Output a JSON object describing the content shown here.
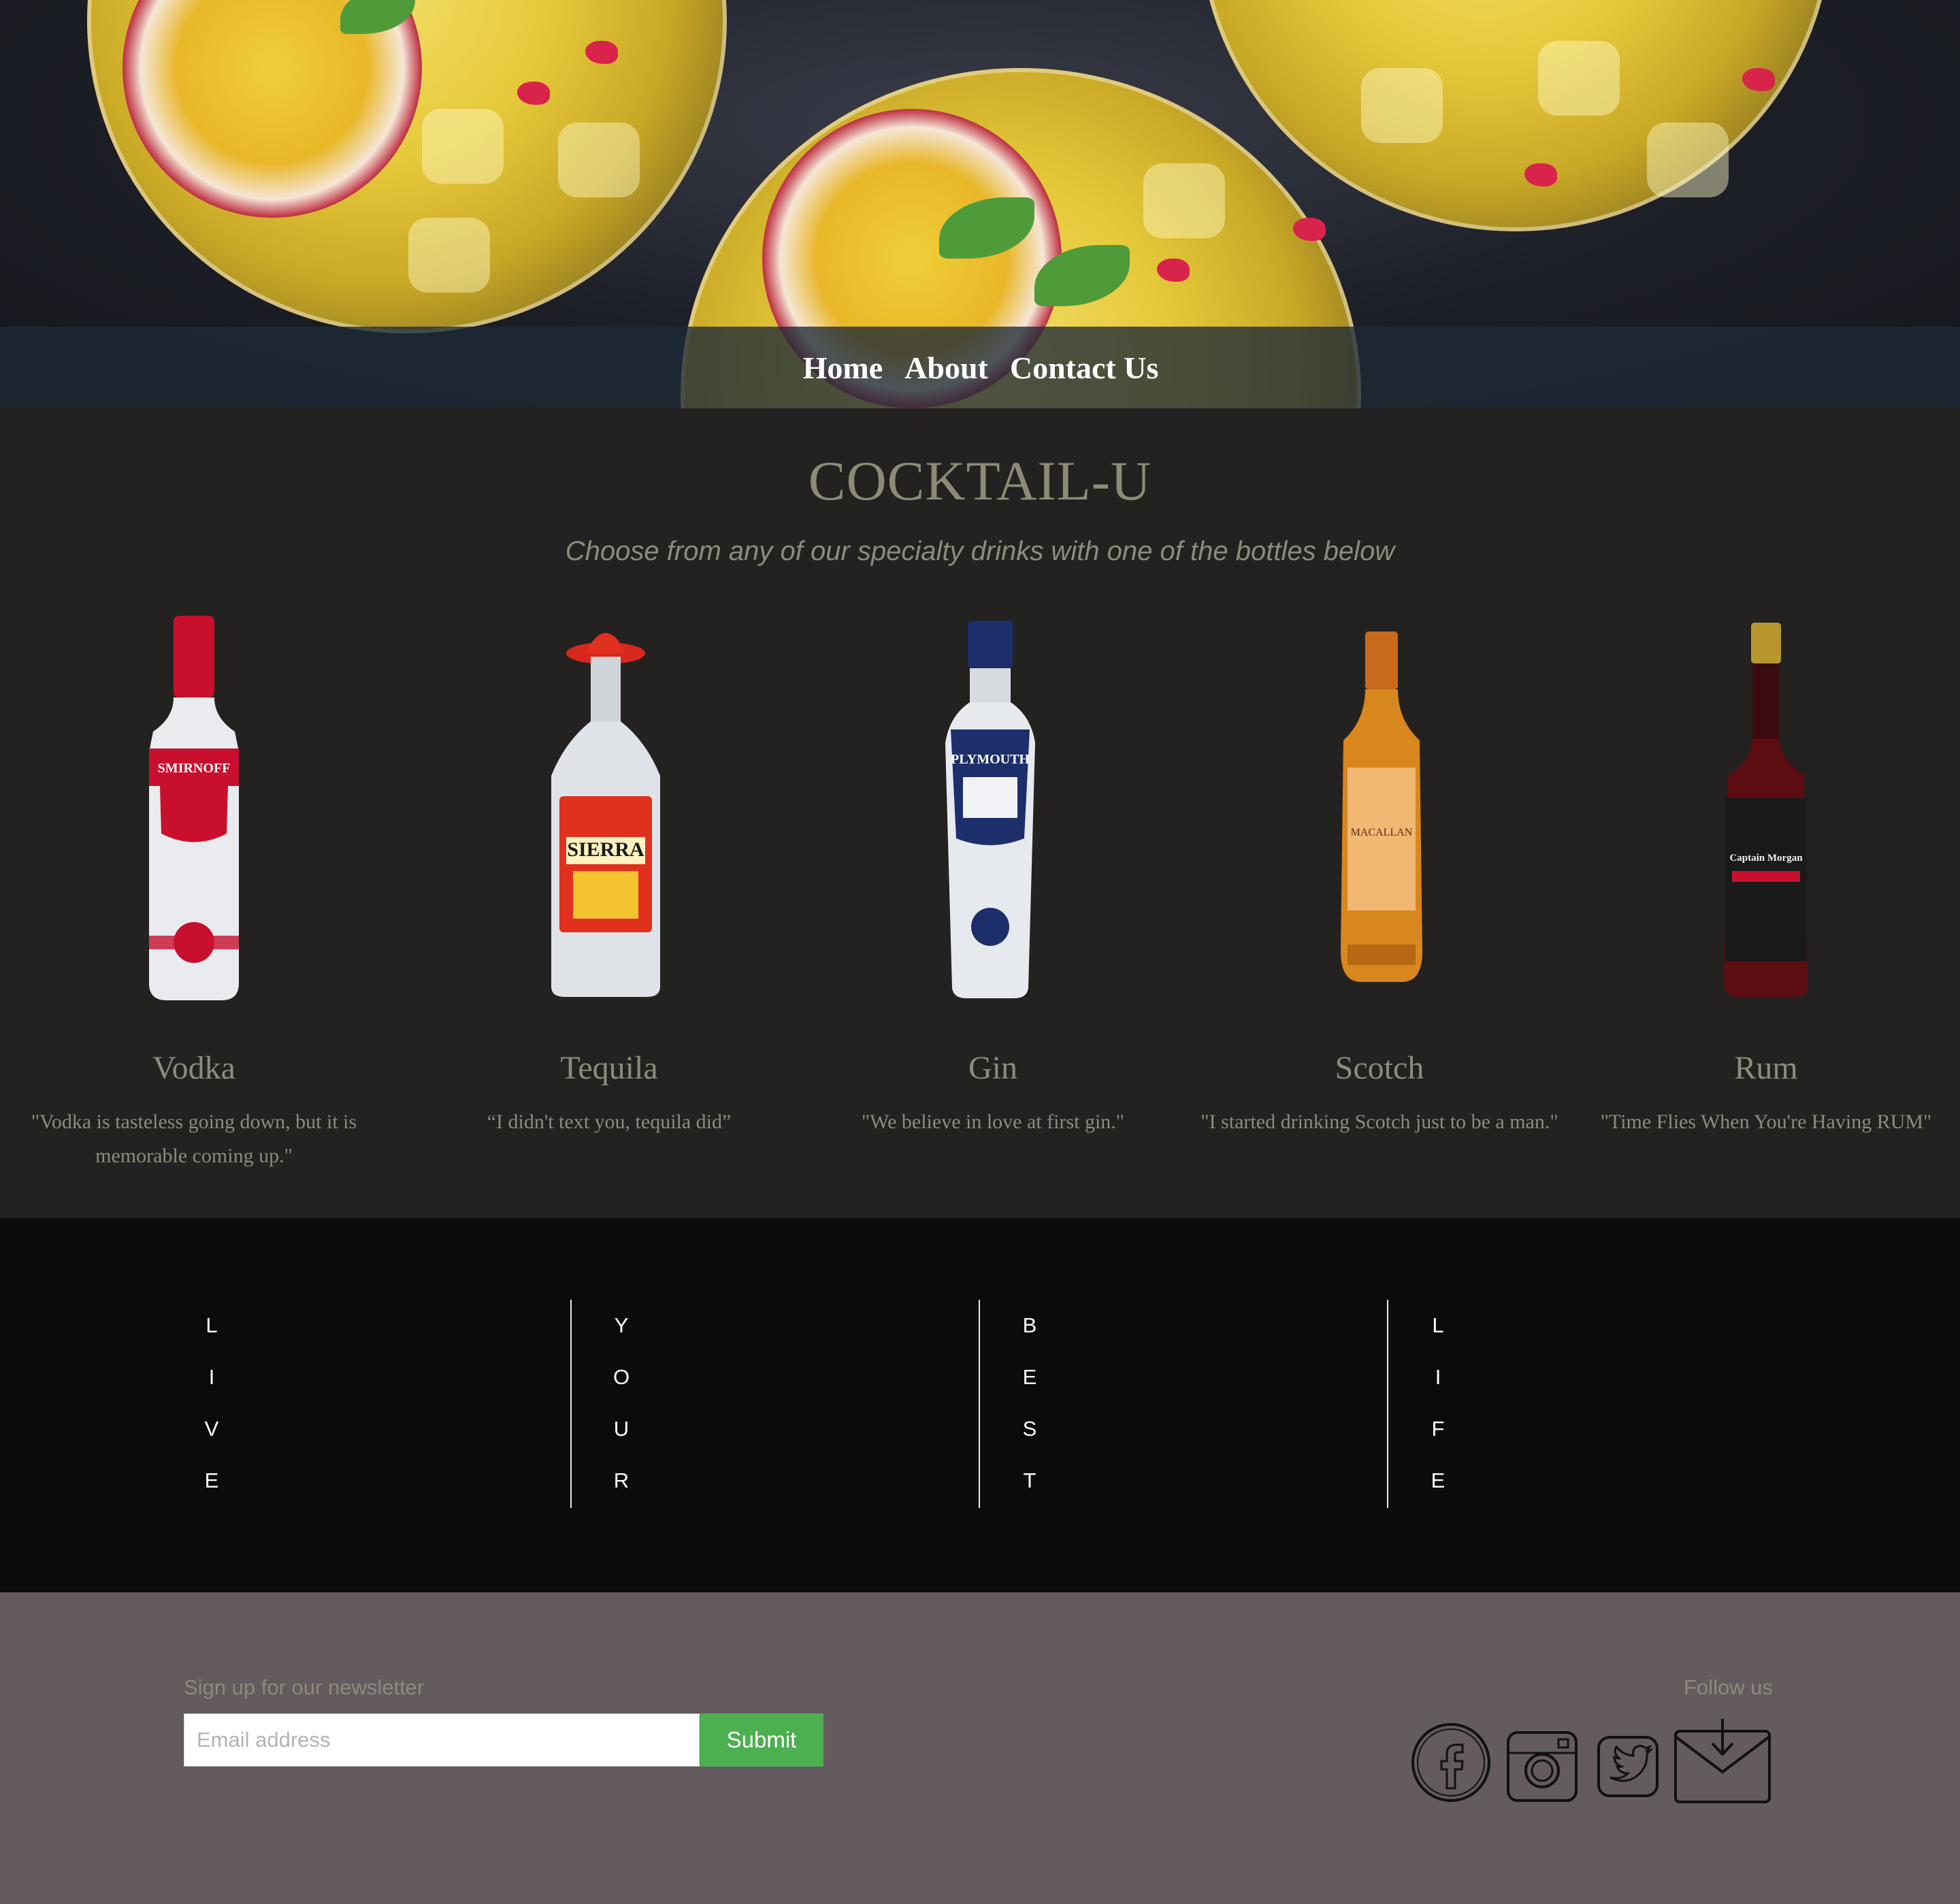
{
  "nav": {
    "home": "Home",
    "about": "About",
    "contact": "Contact Us"
  },
  "header": {
    "title": "COCKTAIL-U",
    "subtitle": "Choose from any of our specialty drinks with one of the bottles below"
  },
  "bottles": [
    {
      "name": "Vodka",
      "quote_line1": "\"Vodka is tasteless going down, but it is",
      "quote_line2": "memorable coming up.\"",
      "label": "SMIRNOFF",
      "color": "#c8102e"
    },
    {
      "name": "Tequila",
      "quote_line1": "“I didn't text you, tequila did”",
      "quote_line2": "",
      "label": "SIERRA",
      "color": "#e0301e"
    },
    {
      "name": "Gin",
      "quote_line1": "\"We believe in love at first gin.\"",
      "quote_line2": "",
      "label": "PLYMOUTH",
      "color": "#1d2f6b"
    },
    {
      "name": "Scotch",
      "quote_line1": "\"I started drinking Scotch just to be a man.\"",
      "quote_line2": "",
      "label": "MACALLAN",
      "color": "#d8871f"
    },
    {
      "name": "Rum",
      "quote_line1": "\"Time Flies When You're Having RUM\"",
      "quote_line2": "",
      "label": "Captain Morgan",
      "color": "#5b0d12"
    }
  ],
  "tagline": {
    "live": [
      "L",
      "I",
      "V",
      "E"
    ],
    "your": [
      "Y",
      "O",
      "U",
      "R"
    ],
    "best": [
      "B",
      "E",
      "S",
      "T"
    ],
    "life": [
      "L",
      "I",
      "F",
      "E"
    ]
  },
  "footer": {
    "newsletter_label": "Sign up for our newsletter",
    "email_placeholder": "Email address",
    "submit_label": "Submit",
    "follow_label": "Follow us",
    "social_icons": [
      "facebook-icon",
      "instagram-icon",
      "twitter-icon",
      "mail-icon"
    ]
  },
  "colors": {
    "products_bg": "#242220",
    "tagline_bg": "#0b0b0b",
    "footer_bg": "#635b5d",
    "submit_bg": "#4caf50",
    "muted_text": "#8d8b7c"
  }
}
